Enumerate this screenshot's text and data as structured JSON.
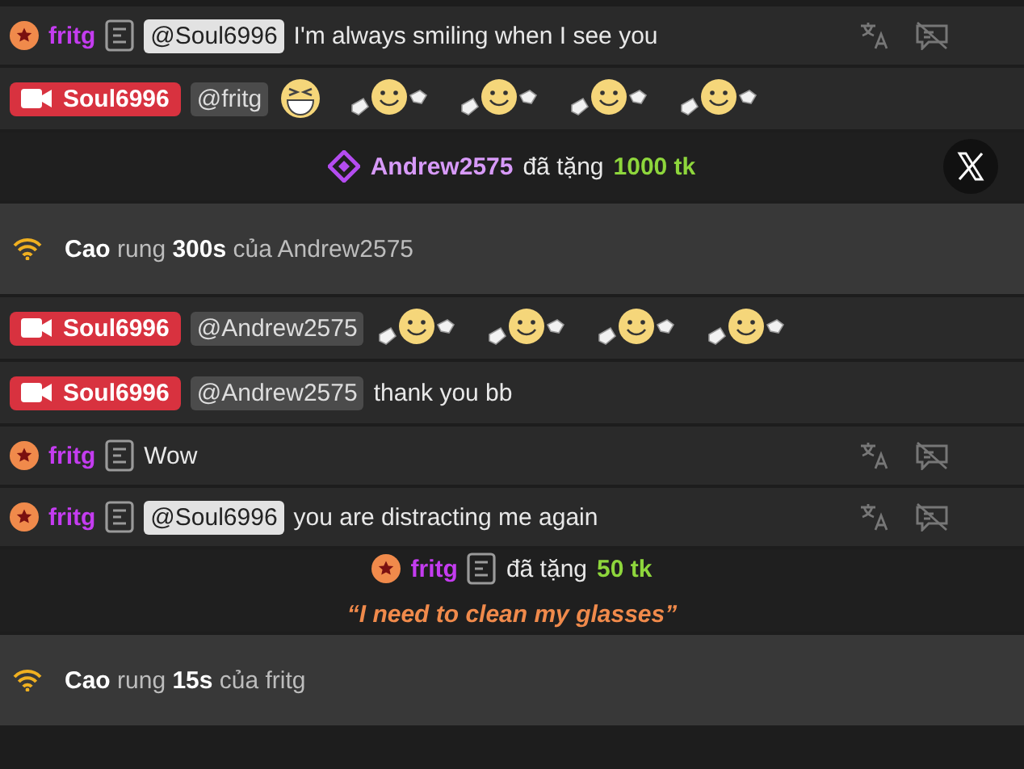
{
  "messages": [
    {
      "kind": "chat",
      "user": {
        "name": "fritg",
        "kind": "member"
      },
      "mention": "@Soul6996",
      "text": "I'm always smiling when I see you",
      "actions": true
    },
    {
      "kind": "chat",
      "user": {
        "name": "Soul6996",
        "kind": "host"
      },
      "mention": "@fritg",
      "emojis": [
        {
          "kind": "laugh"
        },
        {
          "kind": "smile"
        },
        {
          "kind": "smile"
        },
        {
          "kind": "smile"
        },
        {
          "kind": "smile"
        }
      ],
      "actions": false
    },
    {
      "kind": "gift",
      "user": {
        "name": "Andrew2575",
        "kind": "diamond"
      },
      "verb": "đã tặng",
      "amount": "1000 tk",
      "close": true
    },
    {
      "kind": "vibe",
      "text": "**Cao** rung **300s** của Andrew2575"
    },
    {
      "kind": "chat",
      "user": {
        "name": "Soul6996",
        "kind": "host"
      },
      "mention": "@Andrew2575",
      "emojis": [
        {
          "kind": "smile"
        },
        {
          "kind": "smile"
        },
        {
          "kind": "smile"
        },
        {
          "kind": "smile"
        }
      ],
      "actions": false
    },
    {
      "kind": "chat",
      "user": {
        "name": "Soul6996",
        "kind": "host"
      },
      "mention": "@Andrew2575",
      "text": "thank you bb",
      "actions": false
    },
    {
      "kind": "chat",
      "user": {
        "name": "fritg",
        "kind": "member"
      },
      "text": "Wow",
      "actions": true
    },
    {
      "kind": "chat",
      "user": {
        "name": "fritg",
        "kind": "member"
      },
      "mention": "@Soul6996",
      "text": "you are distracting me again",
      "actions": true
    },
    {
      "kind": "gift",
      "user": {
        "name": "fritg",
        "kind": "member"
      },
      "verb": "đã tặng",
      "amount": "50 tk",
      "note": "“I need to clean my glasses”",
      "close": false
    },
    {
      "kind": "vibe",
      "text": "**Cao** rung **15s** của fritg"
    }
  ]
}
